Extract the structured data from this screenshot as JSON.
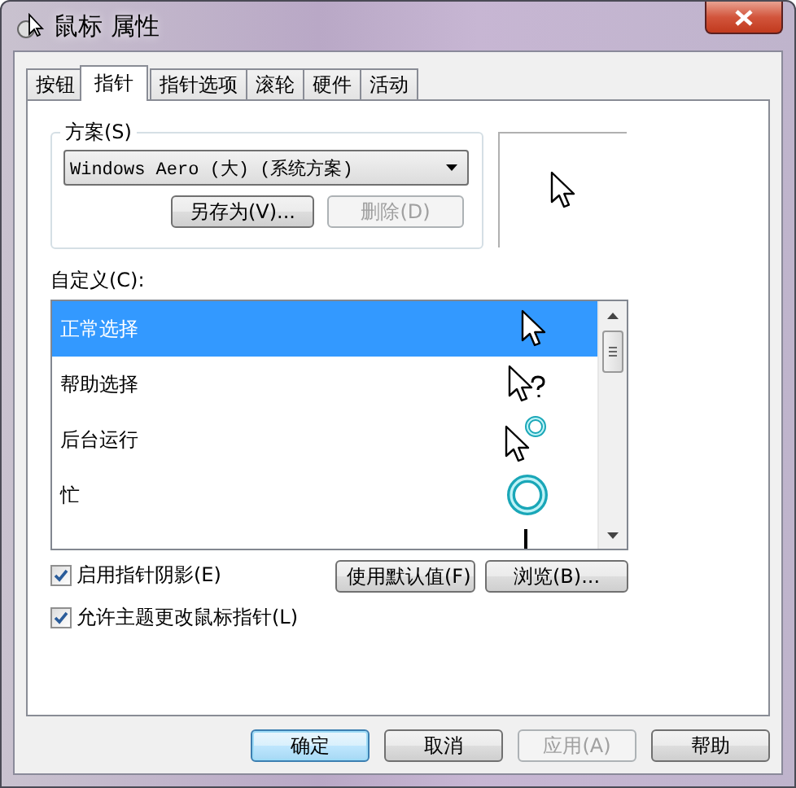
{
  "window": {
    "title": "鼠标 属性"
  },
  "tabs": [
    {
      "label": "按钮",
      "selected": false
    },
    {
      "label": "指针",
      "selected": true
    },
    {
      "label": "指针选项",
      "selected": false
    },
    {
      "label": "滚轮",
      "selected": false
    },
    {
      "label": "硬件",
      "selected": false
    },
    {
      "label": "活动",
      "selected": false
    }
  ],
  "scheme": {
    "label": "方案(S)",
    "value": "Windows Aero (大) (系统方案)",
    "buttons": [
      {
        "label": "另存为(V)...",
        "disabled": false
      },
      {
        "label": "删除(D)",
        "disabled": true
      }
    ]
  },
  "preview": {
    "kind": "arrow"
  },
  "customize": {
    "label": "自定义(C):",
    "items": [
      {
        "label": "正常选择",
        "kind": "arrow",
        "selected": true
      },
      {
        "label": "帮助选择",
        "kind": "help",
        "selected": false
      },
      {
        "label": "后台运行",
        "kind": "working",
        "selected": false
      },
      {
        "label": "忙",
        "kind": "busy",
        "selected": false
      }
    ],
    "partial_row": {
      "kind": "text"
    }
  },
  "options": [
    {
      "label": "启用指针阴影(E)",
      "checked": true
    },
    {
      "label": "允许主题更改鼠标指针(L)",
      "checked": true
    }
  ],
  "list_buttons": [
    {
      "label": "使用默认值(F)",
      "disabled": false
    },
    {
      "label": "浏览(B)...",
      "disabled": false
    }
  ],
  "footer_buttons": [
    {
      "label": "确定",
      "disabled": false,
      "default": true
    },
    {
      "label": "取消",
      "disabled": false,
      "default": false
    },
    {
      "label": "应用(A)",
      "disabled": true,
      "default": false
    },
    {
      "label": "帮助",
      "disabled": false,
      "default": false
    }
  ]
}
